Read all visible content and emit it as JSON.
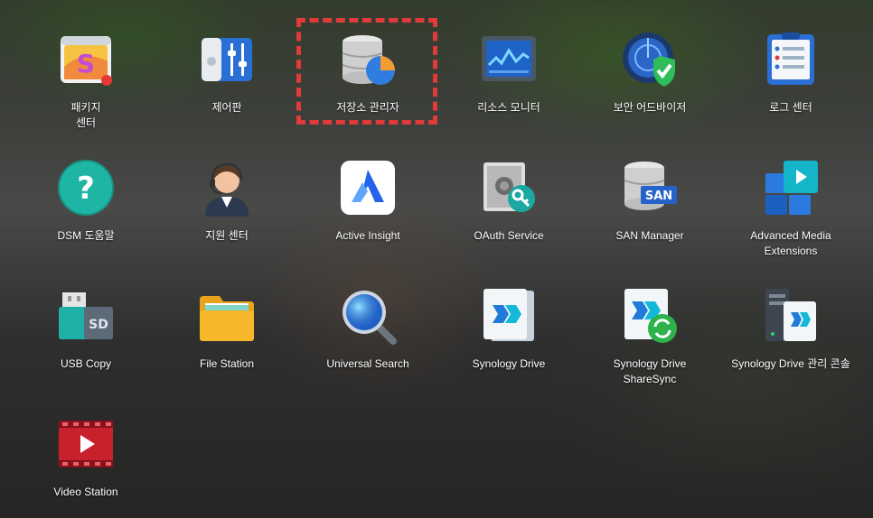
{
  "apps": [
    {
      "id": "package-center",
      "label": "패키지\n센터",
      "icon": "package-center-icon"
    },
    {
      "id": "control-panel",
      "label": "제어판",
      "icon": "control-panel-icon"
    },
    {
      "id": "storage-manager",
      "label": "저장소 관리자",
      "icon": "storage-manager-icon",
      "highlighted": true
    },
    {
      "id": "resource-monitor",
      "label": "리소스 모니터",
      "icon": "resource-monitor-icon"
    },
    {
      "id": "security-advisor",
      "label": "보안 어드바이저",
      "icon": "security-advisor-icon"
    },
    {
      "id": "log-center",
      "label": "로그 센터",
      "icon": "log-center-icon"
    },
    {
      "id": "dsm-help",
      "label": "DSM 도움말",
      "icon": "help-icon"
    },
    {
      "id": "support-center",
      "label": "지원 센터",
      "icon": "support-agent-icon"
    },
    {
      "id": "active-insight",
      "label": "Active Insight",
      "icon": "active-insight-icon"
    },
    {
      "id": "oauth-service",
      "label": "OAuth Service",
      "icon": "oauth-safe-icon"
    },
    {
      "id": "san-manager",
      "label": "SAN Manager",
      "icon": "san-manager-icon"
    },
    {
      "id": "advanced-media",
      "label": "Advanced Media\nExtensions",
      "icon": "media-extensions-icon"
    },
    {
      "id": "usb-copy",
      "label": "USB Copy",
      "icon": "usb-copy-icon"
    },
    {
      "id": "file-station",
      "label": "File Station",
      "icon": "folder-icon"
    },
    {
      "id": "universal-search",
      "label": "Universal Search",
      "icon": "magnifier-icon"
    },
    {
      "id": "synology-drive",
      "label": "Synology Drive",
      "icon": "synology-drive-icon"
    },
    {
      "id": "drive-sharesync",
      "label": "Synology Drive\nShareSync",
      "icon": "drive-sharesync-icon"
    },
    {
      "id": "drive-admin",
      "label": "Synology Drive 관리 콘솔",
      "icon": "drive-admin-console-icon"
    },
    {
      "id": "video-station",
      "label": "Video Station",
      "icon": "video-station-icon"
    }
  ]
}
